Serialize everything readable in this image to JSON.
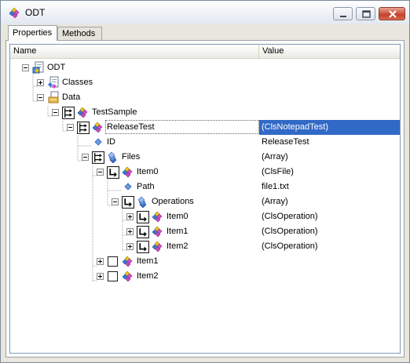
{
  "window": {
    "title": "ODT",
    "title_icon": "diamonds-icon",
    "buttons": [
      "minimize",
      "maximize",
      "close"
    ]
  },
  "tabs": [
    {
      "label": "Properties",
      "active": true
    },
    {
      "label": "Methods",
      "active": false
    }
  ],
  "grid": {
    "columns": [
      "Name",
      "Value"
    ],
    "rows": [
      {
        "name": "ODT",
        "value": "",
        "icon": "config-icon",
        "expander": "minus"
      },
      {
        "name": "Classes",
        "value": "",
        "icon": "class-doc-icon",
        "expander": "plus"
      },
      {
        "name": "Data",
        "value": "",
        "icon": "data-folder-icon",
        "expander": "minus"
      },
      {
        "name": "TestSample",
        "value": "",
        "icon": "diamonds-icon",
        "expander": "minus"
      },
      {
        "name": "ReleaseTest",
        "value": "(ClsNotepadTest)",
        "icon": "diamonds-icon",
        "expander": "minus",
        "selected": true
      },
      {
        "name": "ID",
        "value": "ReleaseTest",
        "icon": "small-diamond-icon"
      },
      {
        "name": "Files",
        "value": "(Array)",
        "icon": "stack-icon",
        "expander": "minus"
      },
      {
        "name": "Item0",
        "value": "(ClsFile)",
        "icon": "diamonds-icon",
        "expander": "minus"
      },
      {
        "name": "Path",
        "value": "file1.txt",
        "icon": "small-diamond-icon"
      },
      {
        "name": "Operations",
        "value": "(Array)",
        "icon": "stack-icon",
        "expander": "minus"
      },
      {
        "name": "Item0",
        "value": "(ClsOperation)",
        "icon": "diamonds-icon",
        "expander": "plus"
      },
      {
        "name": "Item1",
        "value": "(ClsOperation)",
        "icon": "diamonds-icon",
        "expander": "plus"
      },
      {
        "name": "Item2",
        "value": "(ClsOperation)",
        "icon": "diamonds-icon",
        "expander": "plus"
      },
      {
        "name": "Item1",
        "value": "",
        "icon": "diamonds-icon",
        "expander": "plus"
      },
      {
        "name": "Item2",
        "value": "",
        "icon": "diamonds-icon",
        "expander": "plus"
      }
    ]
  },
  "colors": {
    "selection": "#3169c6",
    "window_frame": "#e9e6dd"
  }
}
